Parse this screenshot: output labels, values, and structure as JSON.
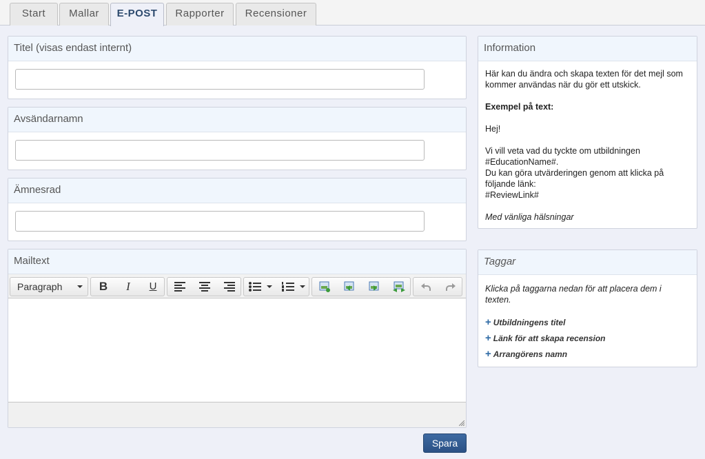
{
  "tabs": [
    {
      "label": "Start"
    },
    {
      "label": "Mallar"
    },
    {
      "label": "E-POST",
      "active": true
    },
    {
      "label": "Rapporter"
    },
    {
      "label": "Recensioner"
    }
  ],
  "form": {
    "title_label": "Titel (visas endast internt)",
    "title_value": "",
    "sender_label": "Avsändarnamn",
    "sender_value": "",
    "subject_label": "Ämnesrad",
    "subject_value": "",
    "mailtext_label": "Mailtext"
  },
  "editor": {
    "format_select": "Paragraph",
    "bold": "B",
    "italic": "I",
    "underline": "U",
    "icons": [
      "bold-icon",
      "italic-icon",
      "underline-icon",
      "align-left-icon",
      "align-center-icon",
      "align-right-icon",
      "bullet-list-icon",
      "numbered-list-icon",
      "insert-image-icon",
      "insert-image-left-icon",
      "insert-image-right-icon",
      "insert-image-link-icon",
      "undo-icon",
      "redo-icon"
    ]
  },
  "info": {
    "title": "Information",
    "intro": "Här kan du ändra och skapa texten för det mejl som kommer användas när du gör ett utskick.",
    "example_heading": "Exempel på text:",
    "greeting": "Hej!",
    "line1": "Vi vill veta vad du tyckte om utbildningen",
    "line2": "#EducationName#.",
    "line3": "Du kan göra utvärderingen genom att klicka på följande länk:",
    "line4": "#ReviewLink#",
    "closing": "Med vänliga hälsningar"
  },
  "tags": {
    "title": "Taggar",
    "hint": "Klicka på taggarna nedan för att placera dem i texten.",
    "items": [
      {
        "label": "Utbildningens titel"
      },
      {
        "label": "Länk för att skapa recension"
      },
      {
        "label": "Arrangörens namn"
      }
    ]
  },
  "actions": {
    "save_label": "Spara"
  },
  "colors": {
    "accent": "#2b5185",
    "panel_header": "#f0f6fd",
    "background": "#eef0f8"
  }
}
